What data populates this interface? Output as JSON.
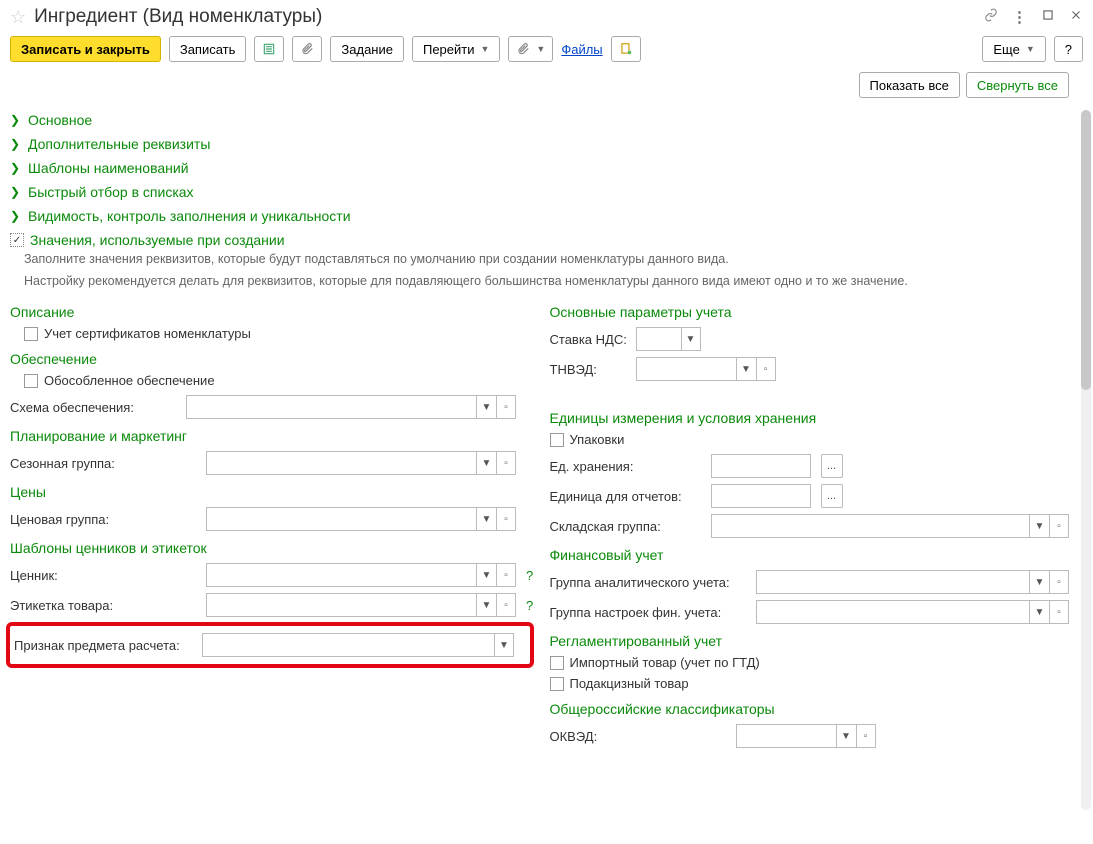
{
  "window": {
    "title": "Ингредиент (Вид номенклатуры)"
  },
  "toolbar": {
    "save_close": "Записать и закрыть",
    "save": "Записать",
    "task": "Задание",
    "goto": "Перейти",
    "files_link": "Файлы",
    "more": "Еще",
    "help": "?"
  },
  "subtoolbar": {
    "show_all": "Показать все",
    "collapse_all": "Свернуть все"
  },
  "sections": {
    "main": "Основное",
    "additional": "Дополнительные реквизиты",
    "name_templates": "Шаблоны наименований",
    "quick_filter": "Быстрый отбор в списках",
    "visibility": "Видимость, контроль заполнения и уникальности",
    "defaults": "Значения, используемые при создании"
  },
  "hints": {
    "line1": "Заполните значения реквизитов, которые будут подставляться по умолчанию при создании номенклатуры данного вида.",
    "line2": "Настройку рекомендуется делать для реквизитов, которые для подавляющего большинства номенклатуры данного вида имеют одно и то же значение."
  },
  "left": {
    "description_h": "Описание",
    "cert_chk": "Учет сертификатов номенклатуры",
    "supply_h": "Обеспечение",
    "separate_chk": "Обособленное обеспечение",
    "supply_scheme": "Схема обеспечения:",
    "planning_h": "Планирование и маркетинг",
    "season_group": "Сезонная группа:",
    "prices_h": "Цены",
    "price_group": "Ценовая группа:",
    "labels_h": "Шаблоны ценников и этикеток",
    "price_tag": "Ценник:",
    "product_label": "Этикетка товара:",
    "calc_subject": "Признак предмета расчета:"
  },
  "right": {
    "accounting_h": "Основные параметры учета",
    "vat": "Ставка НДС:",
    "tnved": "ТНВЭД:",
    "units_h": "Единицы измерения и условия хранения",
    "pack_chk": "Упаковки",
    "storage_unit": "Ед. хранения:",
    "report_unit": "Единица для отчетов:",
    "warehouse_group": "Складская группа:",
    "fin_h": "Финансовый учет",
    "analytic_group": "Группа аналитического учета:",
    "fin_settings_group": "Группа настроек фин. учета:",
    "regulated_h": "Регламентированный учет",
    "import_chk": "Импортный товар (учет по ГТД)",
    "excise_chk": "Подакцизный товар",
    "classifiers_h": "Общероссийские классификаторы",
    "okved": "ОКВЭД:"
  }
}
